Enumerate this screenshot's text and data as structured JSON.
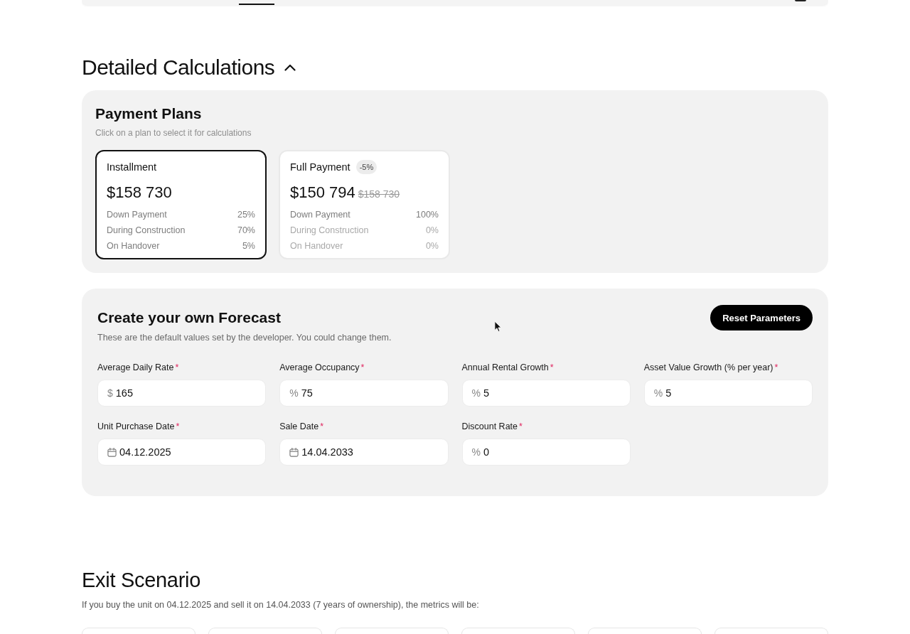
{
  "section": {
    "title": "Detailed Calculations",
    "expanded": true
  },
  "payment_plans": {
    "title": "Payment Plans",
    "subtitle": "Click on a plan to select it for calculations",
    "plans": [
      {
        "name": "Installment",
        "selected": true,
        "price": "$158 730",
        "rows": [
          {
            "label": "Down Payment",
            "value": "25%",
            "dimmed": false
          },
          {
            "label": "During Construction",
            "value": "70%",
            "dimmed": false
          },
          {
            "label": "On Handover",
            "value": "5%",
            "dimmed": false
          }
        ]
      },
      {
        "name": "Full Payment",
        "selected": false,
        "badge": "-5%",
        "price": "$150 794",
        "old_price": "$158 730",
        "rows": [
          {
            "label": "Down Payment",
            "value": "100%",
            "dimmed": false
          },
          {
            "label": "During Construction",
            "value": "0%",
            "dimmed": true
          },
          {
            "label": "On Handover",
            "value": "0%",
            "dimmed": true
          }
        ]
      }
    ]
  },
  "forecast": {
    "title": "Create your own Forecast",
    "subtitle": "These are the default values set by the developer. You could change them.",
    "reset_button": "Reset Parameters",
    "fields": [
      {
        "label": "Average Daily Rate",
        "required_mark": "*",
        "kind": "number",
        "prefix": "$",
        "value": "165"
      },
      {
        "label": "Average Occupancy",
        "required_mark": "*",
        "kind": "number",
        "prefix": "%",
        "value": "75"
      },
      {
        "label": "Annual Rental Growth",
        "required_mark": "*",
        "kind": "number",
        "prefix": "%",
        "value": "5"
      },
      {
        "label": "Asset Value Growth (% per year)",
        "required_mark": "*",
        "kind": "number",
        "prefix": "%",
        "value": "5"
      },
      {
        "label": "Unit Purchase Date",
        "required_mark": "*",
        "kind": "date",
        "value": "04.12.2025"
      },
      {
        "label": "Sale Date",
        "required_mark": "*",
        "kind": "date",
        "value": "14.04.2033"
      },
      {
        "label": "Discount Rate",
        "required_mark": "*",
        "kind": "number",
        "prefix": "%",
        "value": "0"
      }
    ]
  },
  "exit_scenario": {
    "title": "Exit Scenario",
    "subtitle": "If you buy the unit on 04.12.2025 and sell it on 14.04.2033 (7 years of ownership), the metrics will be:"
  }
}
